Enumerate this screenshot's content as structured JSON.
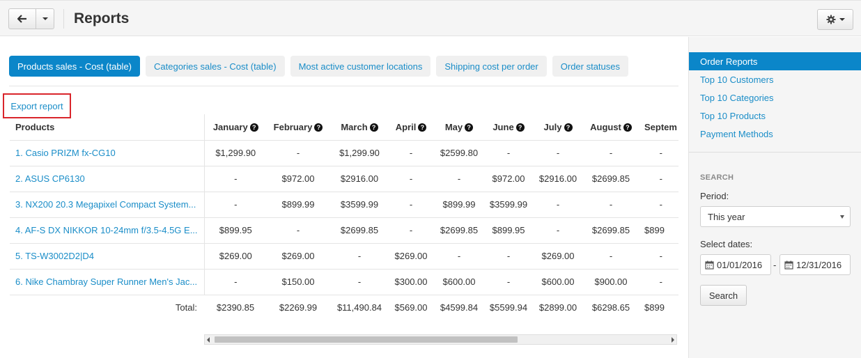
{
  "header": {
    "title": "Reports",
    "back_icon": "arrow-left-icon",
    "settings_icon": "gear-icon"
  },
  "tabs": [
    {
      "label": "Products sales - Cost (table)",
      "active": true
    },
    {
      "label": "Categories sales - Cost (table)",
      "active": false
    },
    {
      "label": "Most active customer locations",
      "active": false
    },
    {
      "label": "Shipping cost per order",
      "active": false
    },
    {
      "label": "Order statuses",
      "active": false
    }
  ],
  "export_label": "Export report",
  "table": {
    "product_header": "Products",
    "month_headers": [
      "January",
      "February",
      "March",
      "April",
      "May",
      "June",
      "July",
      "August",
      "Septem"
    ],
    "rows": [
      {
        "name": "1. Casio PRIZM fx-CG10",
        "values": [
          "$1,299.90",
          "-",
          "$1,299.90",
          "-",
          "$2599.80",
          "-",
          "-",
          "-",
          "-"
        ]
      },
      {
        "name": "2. ASUS CP6130",
        "values": [
          "-",
          "$972.00",
          "$2916.00",
          "-",
          "-",
          "$972.00",
          "$2916.00",
          "$2699.85",
          "-"
        ]
      },
      {
        "name": "3. NX200 20.3 Megapixel Compact System...",
        "values": [
          "-",
          "$899.99",
          "$3599.99",
          "-",
          "$899.99",
          "$3599.99",
          "-",
          "-",
          "-"
        ]
      },
      {
        "name": "4. AF-S DX NIKKOR 10-24mm f/3.5-4.5G E...",
        "values": [
          "$899.95",
          "-",
          "$2699.85",
          "-",
          "$2699.85",
          "$899.95",
          "-",
          "$2699.85",
          "$899"
        ]
      },
      {
        "name": "5. TS-W3002D2|D4",
        "values": [
          "$269.00",
          "$269.00",
          "-",
          "$269.00",
          "-",
          "-",
          "$269.00",
          "-",
          "-"
        ]
      },
      {
        "name": "6. Nike Chambray Super Runner Men's Jac...",
        "values": [
          "-",
          "$150.00",
          "-",
          "$300.00",
          "$600.00",
          "-",
          "$600.00",
          "$900.00",
          "-"
        ]
      }
    ],
    "total_label": "Total:",
    "totals": [
      "$2390.85",
      "$2269.99",
      "$11,490.84",
      "$569.00",
      "$4599.84",
      "$5599.94",
      "$2899.00",
      "$6298.65",
      "$899"
    ]
  },
  "sidebar": {
    "items": [
      {
        "label": "Order Reports",
        "active": true
      },
      {
        "label": "Top 10 Customers",
        "active": false
      },
      {
        "label": "Top 10 Categories",
        "active": false
      },
      {
        "label": "Top 10 Products",
        "active": false
      },
      {
        "label": "Payment Methods",
        "active": false
      }
    ],
    "search_title": "SEARCH",
    "period_label": "Period:",
    "period_value": "This year",
    "dates_label": "Select dates:",
    "date_from": "01/01/2016",
    "date_to": "12/31/2016",
    "date_separator": "-",
    "search_button": "Search"
  },
  "colors": {
    "accent": "#0b86c9",
    "link": "#1a8dc8",
    "highlight_border": "#d9252b"
  }
}
